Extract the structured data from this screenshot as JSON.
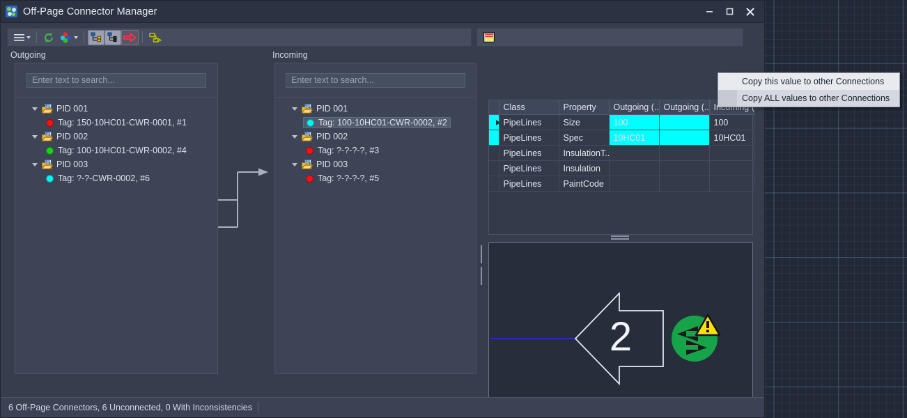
{
  "window": {
    "title": "Off-Page Connector Manager",
    "app_icon": "connector-manager-icon",
    "minimize_label": "Minimize",
    "maximize_label": "Maximize",
    "close_label": "Close"
  },
  "toolbar_left": {
    "menu_button": "menu-icon",
    "refresh_button": "refresh-icon",
    "colors_button": "color-filter-icon",
    "show_tree_button": "show-connections-tree-icon",
    "show_list_button": "show-list-icon",
    "go_to_button": "go-to-connector-icon",
    "link_button": "link-connector-icon"
  },
  "toolbar_right": {
    "properties_button": "property-stripes-icon"
  },
  "outgoing": {
    "label": "Outgoing",
    "search": {
      "placeholder": "Enter text to search...",
      "value": ""
    },
    "nodes": [
      {
        "label": "PID 001",
        "icon": "pid-folder-icon",
        "expanded": true,
        "children": [
          {
            "label": "Tag: 150-10HC01-CWR-0001, #1",
            "status_color": "#f01515",
            "selected": false
          }
        ]
      },
      {
        "label": "PID 002",
        "icon": "pid-folder-icon",
        "expanded": true,
        "children": [
          {
            "label": "Tag: 100-10HC01-CWR-0002, #4",
            "status_color": "#19d219",
            "selected": false
          }
        ]
      },
      {
        "label": "PID 003",
        "icon": "pid-folder-icon",
        "expanded": true,
        "children": [
          {
            "label": "Tag: ?-?-CWR-0002, #6",
            "status_color": "#0ff0f0",
            "selected": false
          }
        ]
      }
    ]
  },
  "incoming": {
    "label": "Incoming",
    "search": {
      "placeholder": "Enter text to search...",
      "value": ""
    },
    "nodes": [
      {
        "label": "PID 001",
        "icon": "pid-folder-icon",
        "expanded": true,
        "children": [
          {
            "label": "Tag: 100-10HC01-CWR-0002, #2",
            "status_color": "#0ff0f0",
            "selected": true
          }
        ]
      },
      {
        "label": "PID 002",
        "icon": "pid-folder-icon",
        "expanded": true,
        "children": [
          {
            "label": "Tag: ?-?-?-?, #3",
            "status_color": "#f01515",
            "selected": false
          }
        ]
      },
      {
        "label": "PID 003",
        "icon": "pid-folder-icon",
        "expanded": true,
        "children": [
          {
            "label": "Tag: ?-?-?-?, #5",
            "status_color": "#f01515",
            "selected": false
          }
        ]
      }
    ]
  },
  "property_grid": {
    "columns": [
      "Class",
      "Property",
      "Outgoing (...",
      "Outgoing (...",
      "Incoming (P..."
    ],
    "rows": [
      {
        "selected": true,
        "cells": [
          "PipeLines",
          "Size",
          "100",
          "",
          "100"
        ],
        "highlight": [
          false,
          false,
          false,
          true,
          true
        ]
      },
      {
        "selected": false,
        "cells": [
          "PipeLines",
          "Spec",
          "10HC01",
          "",
          "10HC01"
        ],
        "highlight": [
          false,
          false,
          false,
          true,
          true
        ]
      },
      {
        "selected": false,
        "cells": [
          "PipeLines",
          "InsulationT...",
          "",
          "",
          ""
        ],
        "highlight": [
          false,
          false,
          false,
          false,
          false
        ]
      },
      {
        "selected": false,
        "cells": [
          "PipeLines",
          "Insulation",
          "",
          "",
          ""
        ],
        "highlight": [
          false,
          false,
          false,
          false,
          false
        ]
      },
      {
        "selected": false,
        "cells": [
          "PipeLines",
          "PaintCode",
          "",
          "",
          ""
        ],
        "highlight": [
          false,
          false,
          false,
          false,
          false
        ]
      }
    ]
  },
  "context_menu": {
    "items": [
      {
        "label": "Copy this value to other Connections",
        "hovered": true
      },
      {
        "label": "Copy ALL values to other Connections",
        "hovered": false
      }
    ]
  },
  "preview": {
    "connector_number": "2",
    "arrow_icon": "off-page-connector-arrow",
    "sync_icon": "sync-arrows-icon",
    "warning_icon": "warning-triangle-icon",
    "pipe_line_color": "#2b2bd8",
    "sync_color": "#16a34a",
    "warning_color": "#ffe000"
  },
  "status_bar": {
    "text": "6 Off-Page Connectors, 6 Unconnected, 0 With Inconsistencies"
  },
  "colors": {
    "accent_cyan": "#00ffff",
    "window_bg": "#363e4e",
    "panel_bg": "#3c4456",
    "titlebar_bg": "#2b3241"
  }
}
